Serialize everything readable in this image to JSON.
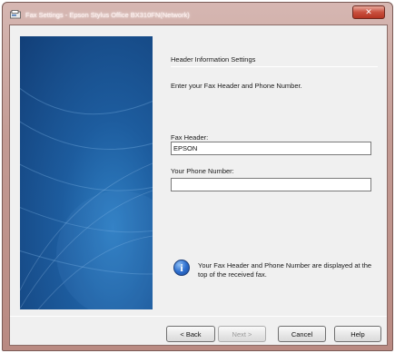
{
  "window": {
    "title": "Fax Settings - Epson Stylus Office BX310FN(Network)",
    "close_label": "✕"
  },
  "main": {
    "section_title": "Header Information Settings",
    "instruction": "Enter your Fax Header and Phone Number.",
    "fax_header": {
      "label": "Fax Header:",
      "value": "EPSON"
    },
    "phone_number": {
      "label": "Your Phone Number:",
      "value": ""
    },
    "info": {
      "icon": "info-icon",
      "glyph": "i",
      "text": "Your Fax Header and Phone Number are displayed at the top of the received fax."
    }
  },
  "buttons": {
    "back": "< Back",
    "next": "Next >",
    "cancel": "Cancel",
    "help": "Help"
  },
  "colors": {
    "banner": "#1d5c9e",
    "titlebar": "#c39a93",
    "close": "#c9503e"
  }
}
